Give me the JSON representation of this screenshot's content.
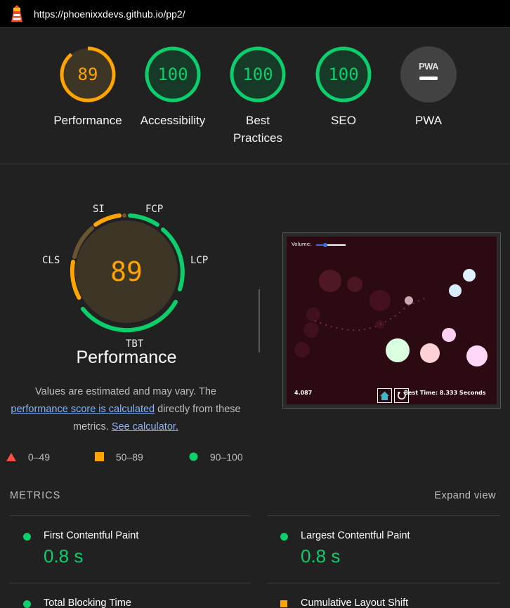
{
  "url": "https://phoenixxdevs.github.io/pp2/",
  "colors": {
    "pass": "#0cce6b",
    "average": "#ffa400",
    "fail": "#ff4e42",
    "background": "#212121"
  },
  "scores": [
    {
      "value": "89",
      "label": "Performance",
      "level": "average",
      "fraction": 0.89
    },
    {
      "value": "100",
      "label": "Accessibility",
      "level": "pass",
      "fraction": 1.0
    },
    {
      "value": "100",
      "label": "Best Practices",
      "level": "pass",
      "fraction": 1.0
    },
    {
      "value": "100",
      "label": "SEO",
      "level": "pass",
      "fraction": 1.0
    },
    {
      "value": "—",
      "label": "PWA",
      "level": "na",
      "badge": "PWA"
    }
  ],
  "performance": {
    "score": "89",
    "title": "Performance",
    "metric_labels": {
      "si": "SI",
      "fcp": "FCP",
      "lcp": "LCP",
      "tbt": "TBT",
      "cls": "CLS"
    },
    "description_pre": "Values are estimated and may vary. The",
    "description_link": "performance score is calculated",
    "description_mid": "directly from these metrics.",
    "calculator_link": "See calculator."
  },
  "legend": [
    {
      "range": "0–49",
      "shape": "triangle",
      "color": "#ff4e42"
    },
    {
      "range": "50–89",
      "shape": "square",
      "color": "#ffa400"
    },
    {
      "range": "90–100",
      "shape": "circle",
      "color": "#0cce6b"
    }
  ],
  "screenshot": {
    "volume_label": "Volume:",
    "counter": "4.087",
    "best_time": "Best Time: 8.333 Seconds"
  },
  "metrics": {
    "heading": "METRICS",
    "expand_label": "Expand view",
    "items": [
      {
        "name": "First Contentful Paint",
        "value": "0.8 s",
        "level": "pass"
      },
      {
        "name": "Largest Contentful Paint",
        "value": "0.8 s",
        "level": "pass"
      },
      {
        "name": "Total Blocking Time",
        "value": "",
        "level": "pass"
      },
      {
        "name": "Cumulative Layout Shift",
        "value": "",
        "level": "average"
      }
    ]
  }
}
